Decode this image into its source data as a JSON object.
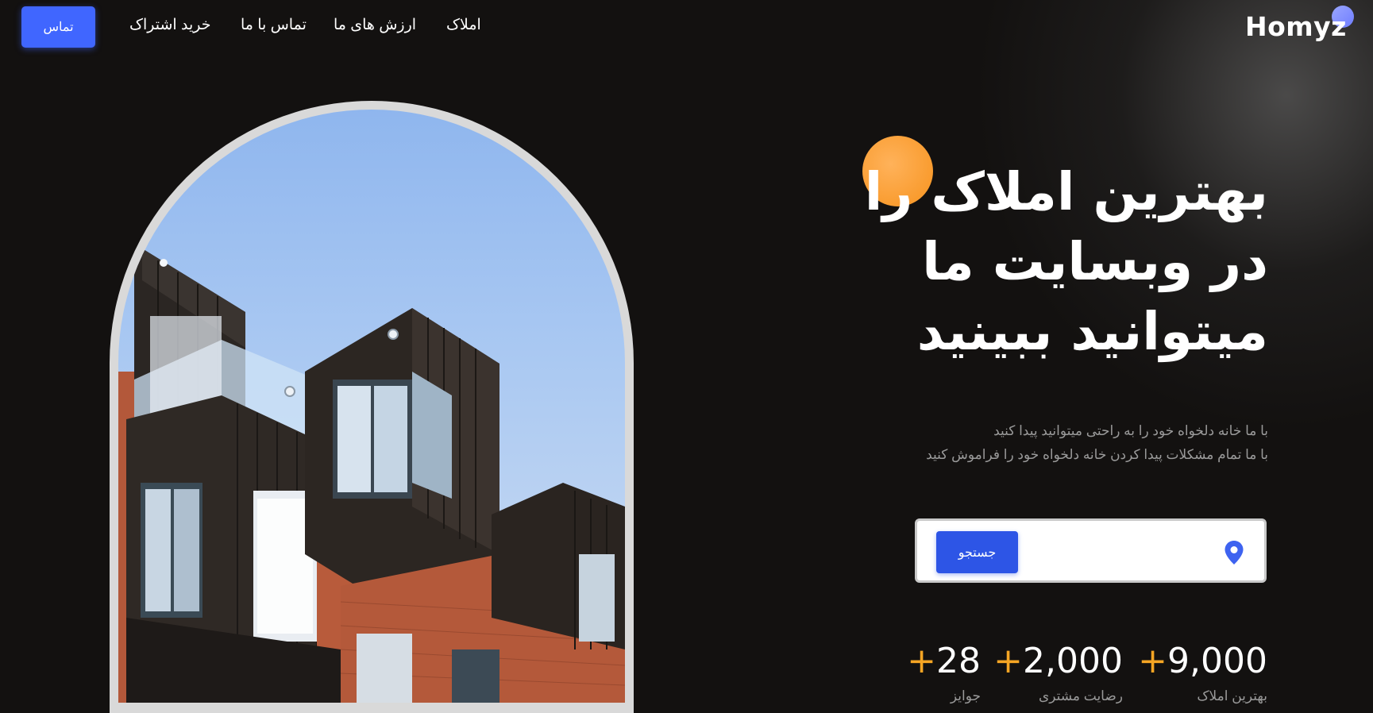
{
  "header": {
    "logo": "Homyz",
    "nav": [
      "املاک",
      "ارزش های ما",
      "تماس با ما",
      "خرید اشتراک"
    ],
    "contact_button": "تماس"
  },
  "hero": {
    "headline": [
      "بهترین املاک را",
      "در وبسایت ما",
      "میتوانید ببینید"
    ],
    "subtext": [
      "با ما خانه دلخواه خود را به راحتی میتوانید پیدا کنید",
      "با ما تمام مشکلات پیدا کردن خانه دلخواه خود را فراموش کنید"
    ],
    "search": {
      "button_label": "جستجو",
      "input_value": "",
      "placeholder": ""
    },
    "stats": [
      {
        "value": "9,000",
        "plus": "+",
        "label": "بهترین املاک"
      },
      {
        "value": "2,000",
        "plus": "+",
        "label": "رضایت مشتری"
      },
      {
        "value": "28",
        "plus": "+",
        "label": "جوایز"
      }
    ]
  },
  "colors": {
    "accent": "#4066ff",
    "orange": "#f7931e",
    "background": "#131110"
  },
  "icons": {
    "location": "location-pin-icon"
  }
}
